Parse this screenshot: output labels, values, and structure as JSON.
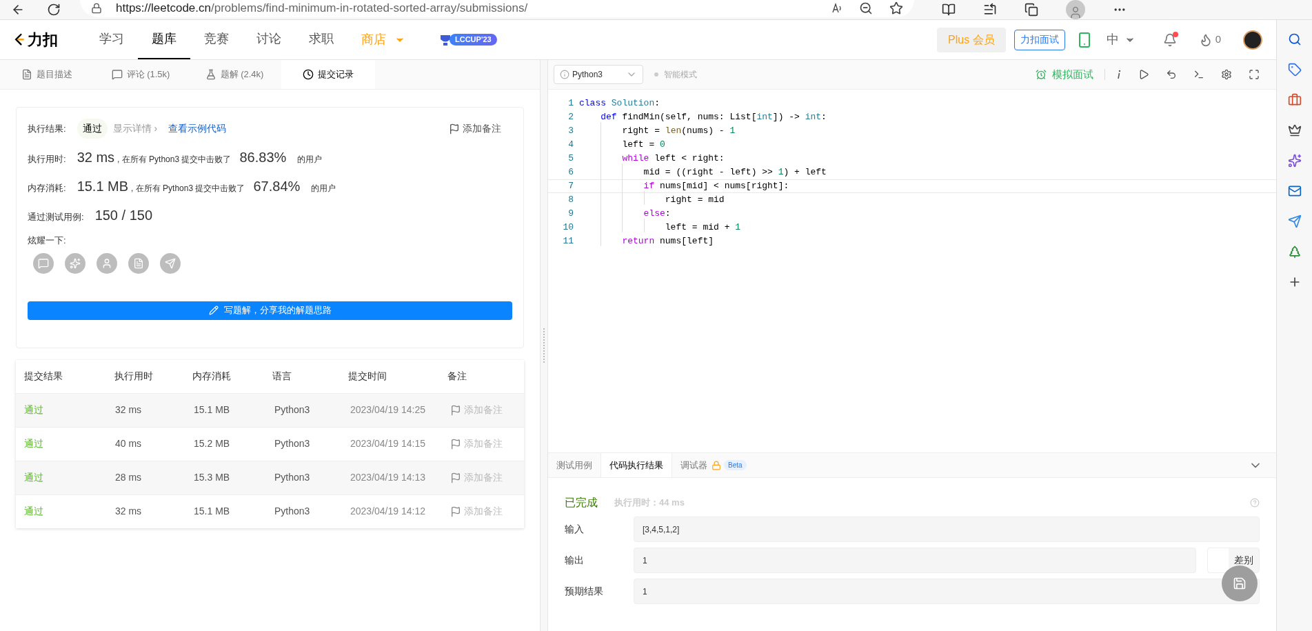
{
  "browser": {
    "url_host": "https://leetcode.cn",
    "url_path": "/problems/find-minimum-in-rotated-sorted-array/submissions/"
  },
  "nav": {
    "logo": "力扣",
    "items": [
      {
        "label": "学习",
        "selected": false
      },
      {
        "label": "题库",
        "selected": true
      },
      {
        "label": "竞赛",
        "selected": false
      },
      {
        "label": "讨论",
        "selected": false
      },
      {
        "label": "求职",
        "selected": false
      }
    ],
    "store": "商店",
    "badge": "LCCUP'23",
    "plus": "Plus 会员",
    "interview": "力扣面试",
    "language": "中",
    "notification": true,
    "streak": "0"
  },
  "left_tabs": [
    {
      "label": "题目描述",
      "selected": false
    },
    {
      "label": "评论 (1.5k)",
      "selected": false
    },
    {
      "label": "题解 (2.4k)",
      "selected": false
    },
    {
      "label": "提交记录",
      "selected": true
    }
  ],
  "result": {
    "label": "执行结果:",
    "status": "通过",
    "details": "显示详情 ›",
    "sample_link": "查看示例代码",
    "add_note": "添加备注",
    "stats": [
      {
        "label": "执行用时:",
        "value": "32 ms",
        "text": ", 在所有 Python3 提交中击败了",
        "percent": "86.83%",
        "suffix": "的用户"
      },
      {
        "label": "内存消耗:",
        "value": "15.1 MB",
        "text": ", 在所有 Python3 提交中击败了",
        "percent": "67.84%",
        "suffix": "的用户"
      }
    ],
    "cases_label": "通过测试用例:",
    "cases": "150 / 150",
    "share_label": "炫耀一下:",
    "write_button": "写题解，分享我的解题思路"
  },
  "table": {
    "columns": [
      "提交结果",
      "执行用时",
      "内存消耗",
      "语言",
      "提交时间",
      "备注"
    ],
    "rows": [
      {
        "status": "通过",
        "time": "32 ms",
        "memory": "15.1 MB",
        "language": "Python3",
        "submitted": "2023/04/19 14:25",
        "note": "添加备注"
      },
      {
        "status": "通过",
        "time": "40 ms",
        "memory": "15.2 MB",
        "language": "Python3",
        "submitted": "2023/04/19 14:15",
        "note": "添加备注"
      },
      {
        "status": "通过",
        "time": "28 ms",
        "memory": "15.3 MB",
        "language": "Python3",
        "submitted": "2023/04/19 14:13",
        "note": "添加备注"
      },
      {
        "status": "通过",
        "time": "32 ms",
        "memory": "15.1 MB",
        "language": "Python3",
        "submitted": "2023/04/19 14:12",
        "note": "添加备注"
      }
    ]
  },
  "editor": {
    "language": "Python3",
    "smart_mode": "智能模式",
    "mock_interview": "模拟面试",
    "lines": [
      {
        "number": "1",
        "current": false,
        "tokens": [
          {
            "kind": "keyword",
            "text": "class"
          },
          {
            "kind": "type",
            "text": " Solution"
          },
          {
            "kind": "plain",
            "text": ":"
          }
        ]
      },
      {
        "number": "2",
        "current": false,
        "tokens": [
          {
            "kind": "keyword",
            "text": "    def"
          },
          {
            "kind": "plain",
            "text": " findMin(self, nums: List["
          },
          {
            "kind": "type",
            "text": "int"
          },
          {
            "kind": "plain",
            "text": "]) -> "
          },
          {
            "kind": "type",
            "text": "int"
          },
          {
            "kind": "plain",
            "text": ":"
          }
        ]
      },
      {
        "number": "3",
        "current": false,
        "tokens": [
          {
            "kind": "plain",
            "text": "        right = "
          },
          {
            "kind": "builtin",
            "text": "len"
          },
          {
            "kind": "plain",
            "text": "(nums) - "
          },
          {
            "kind": "number",
            "text": "1"
          }
        ]
      },
      {
        "number": "4",
        "current": false,
        "tokens": [
          {
            "kind": "plain",
            "text": "        left = "
          },
          {
            "kind": "number",
            "text": "0"
          }
        ]
      },
      {
        "number": "5",
        "current": false,
        "tokens": [
          {
            "kind": "control",
            "text": "        while"
          },
          {
            "kind": "plain",
            "text": " left < right:"
          }
        ]
      },
      {
        "number": "6",
        "current": false,
        "tokens": [
          {
            "kind": "plain",
            "text": "            mid = ((right - left) >> "
          },
          {
            "kind": "number",
            "text": "1"
          },
          {
            "kind": "plain",
            "text": ") + left"
          }
        ]
      },
      {
        "number": "7",
        "current": true,
        "tokens": [
          {
            "kind": "control",
            "text": "            if"
          },
          {
            "kind": "plain",
            "text": " nums[mid] < nums[right]:"
          }
        ]
      },
      {
        "number": "8",
        "current": false,
        "tokens": [
          {
            "kind": "plain",
            "text": "                right = mid"
          }
        ]
      },
      {
        "number": "9",
        "current": false,
        "tokens": [
          {
            "kind": "control",
            "text": "            else"
          },
          {
            "kind": "plain",
            "text": ":"
          }
        ]
      },
      {
        "number": "10",
        "current": false,
        "tokens": [
          {
            "kind": "plain",
            "text": "                left = mid + "
          },
          {
            "kind": "number",
            "text": "1"
          }
        ]
      },
      {
        "number": "11",
        "current": false,
        "tokens": [
          {
            "kind": "control",
            "text": "        return"
          },
          {
            "kind": "plain",
            "text": " nums[left]"
          }
        ]
      }
    ]
  },
  "console": {
    "tabs": [
      {
        "label": "测试用例",
        "selected": false
      },
      {
        "label": "代码执行结果",
        "selected": true
      },
      {
        "label": "调试器",
        "selected": false,
        "locked": true,
        "badge": "Beta"
      }
    ],
    "status": "已完成",
    "runtime": "执行用时：44 ms",
    "fields": [
      {
        "label": "输入",
        "value": "[3,4,5,1,2]"
      },
      {
        "label": "输出",
        "value": "1"
      },
      {
        "label": "预期结果",
        "value": "1"
      }
    ],
    "diff": "差别"
  }
}
